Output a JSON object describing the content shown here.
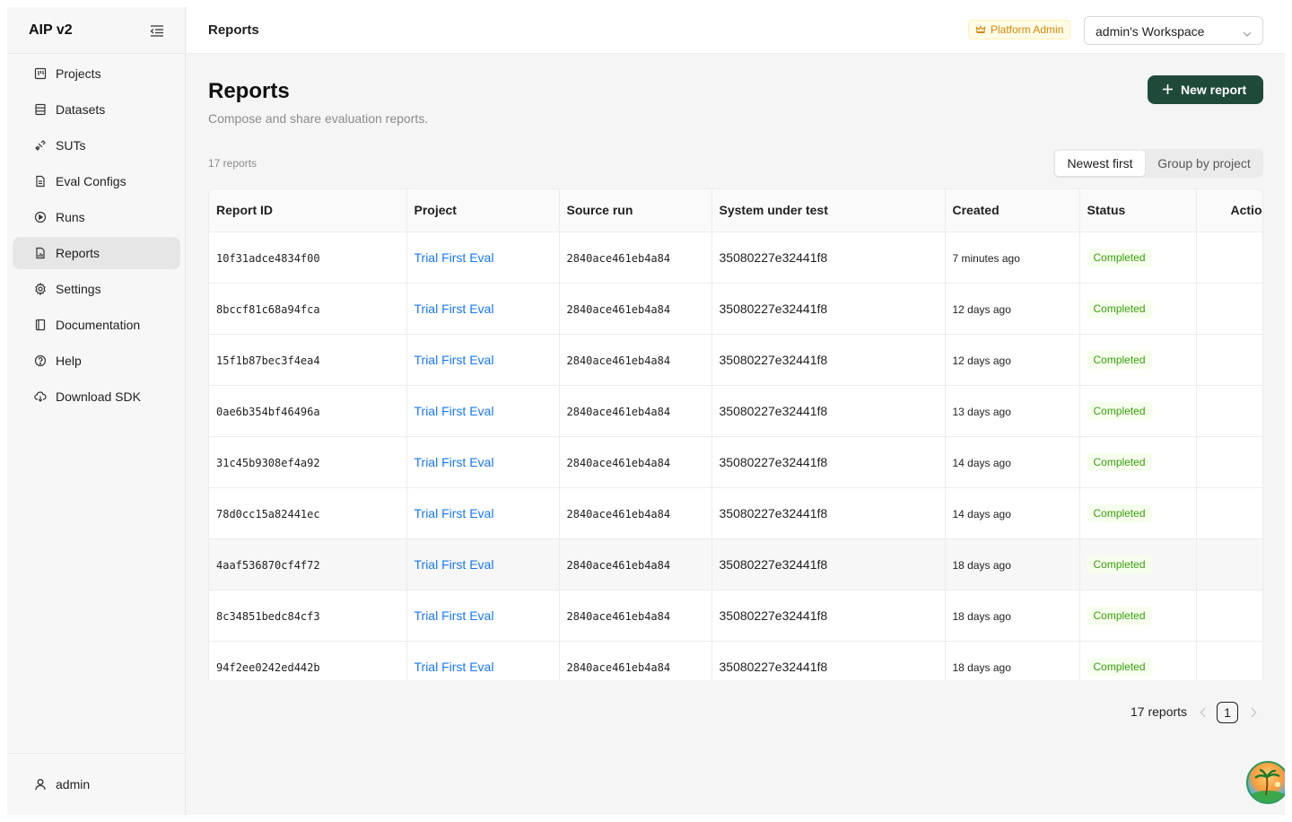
{
  "app": {
    "name": "AIP v2"
  },
  "sidebar": {
    "items": [
      {
        "label": "Projects",
        "icon": "projects-icon",
        "active": false
      },
      {
        "label": "Datasets",
        "icon": "datasets-icon",
        "active": false
      },
      {
        "label": "SUTs",
        "icon": "suts-icon",
        "active": false
      },
      {
        "label": "Eval Configs",
        "icon": "eval-configs-icon",
        "active": false
      },
      {
        "label": "Runs",
        "icon": "runs-icon",
        "active": false
      },
      {
        "label": "Reports",
        "icon": "reports-icon",
        "active": true
      },
      {
        "label": "Settings",
        "icon": "settings-icon",
        "active": false
      },
      {
        "label": "Documentation",
        "icon": "documentation-icon",
        "active": false
      },
      {
        "label": "Help",
        "icon": "help-icon",
        "active": false
      },
      {
        "label": "Download SDK",
        "icon": "download-sdk-icon",
        "active": false
      }
    ],
    "user": "admin"
  },
  "header": {
    "title": "Reports",
    "badge": "Platform Admin",
    "workspace": "admin's Workspace"
  },
  "page": {
    "title": "Reports",
    "subtitle": "Compose and share evaluation reports.",
    "new_button": "New report",
    "count_label": "17 reports",
    "sort_options": [
      "Newest first",
      "Group by project"
    ],
    "selected_sort": "Newest first"
  },
  "table": {
    "columns": [
      "Report ID",
      "Project",
      "Source run",
      "System under test",
      "Created",
      "Status",
      "Actions"
    ],
    "rows": [
      {
        "id": "10f31adce4834f00",
        "project": "Trial First Eval",
        "run": "2840ace461eb4a84",
        "sut": "35080227e32441f8",
        "created": "7 minutes ago",
        "status": "Completed"
      },
      {
        "id": "8bccf81c68a94fca",
        "project": "Trial First Eval",
        "run": "2840ace461eb4a84",
        "sut": "35080227e32441f8",
        "created": "12 days ago",
        "status": "Completed"
      },
      {
        "id": "15f1b87bec3f4ea4",
        "project": "Trial First Eval",
        "run": "2840ace461eb4a84",
        "sut": "35080227e32441f8",
        "created": "12 days ago",
        "status": "Completed"
      },
      {
        "id": "0ae6b354bf46496a",
        "project": "Trial First Eval",
        "run": "2840ace461eb4a84",
        "sut": "35080227e32441f8",
        "created": "13 days ago",
        "status": "Completed"
      },
      {
        "id": "31c45b9308ef4a92",
        "project": "Trial First Eval",
        "run": "2840ace461eb4a84",
        "sut": "35080227e32441f8",
        "created": "14 days ago",
        "status": "Completed"
      },
      {
        "id": "78d0cc15a82441ec",
        "project": "Trial First Eval",
        "run": "2840ace461eb4a84",
        "sut": "35080227e32441f8",
        "created": "14 days ago",
        "status": "Completed"
      },
      {
        "id": "4aaf536870cf4f72",
        "project": "Trial First Eval",
        "run": "2840ace461eb4a84",
        "sut": "35080227e32441f8",
        "created": "18 days ago",
        "status": "Completed"
      },
      {
        "id": "8c34851bedc84cf3",
        "project": "Trial First Eval",
        "run": "2840ace461eb4a84",
        "sut": "35080227e32441f8",
        "created": "18 days ago",
        "status": "Completed"
      },
      {
        "id": "94f2ee0242ed442b",
        "project": "Trial First Eval",
        "run": "2840ace461eb4a84",
        "sut": "35080227e32441f8",
        "created": "18 days ago",
        "status": "Completed"
      }
    ]
  },
  "pagination": {
    "total_label": "17 reports",
    "current_page": "1"
  },
  "colors": {
    "primary": "#1f4a3a",
    "link": "#1677ff",
    "success": "#389e0d",
    "badge": "#d48806"
  }
}
